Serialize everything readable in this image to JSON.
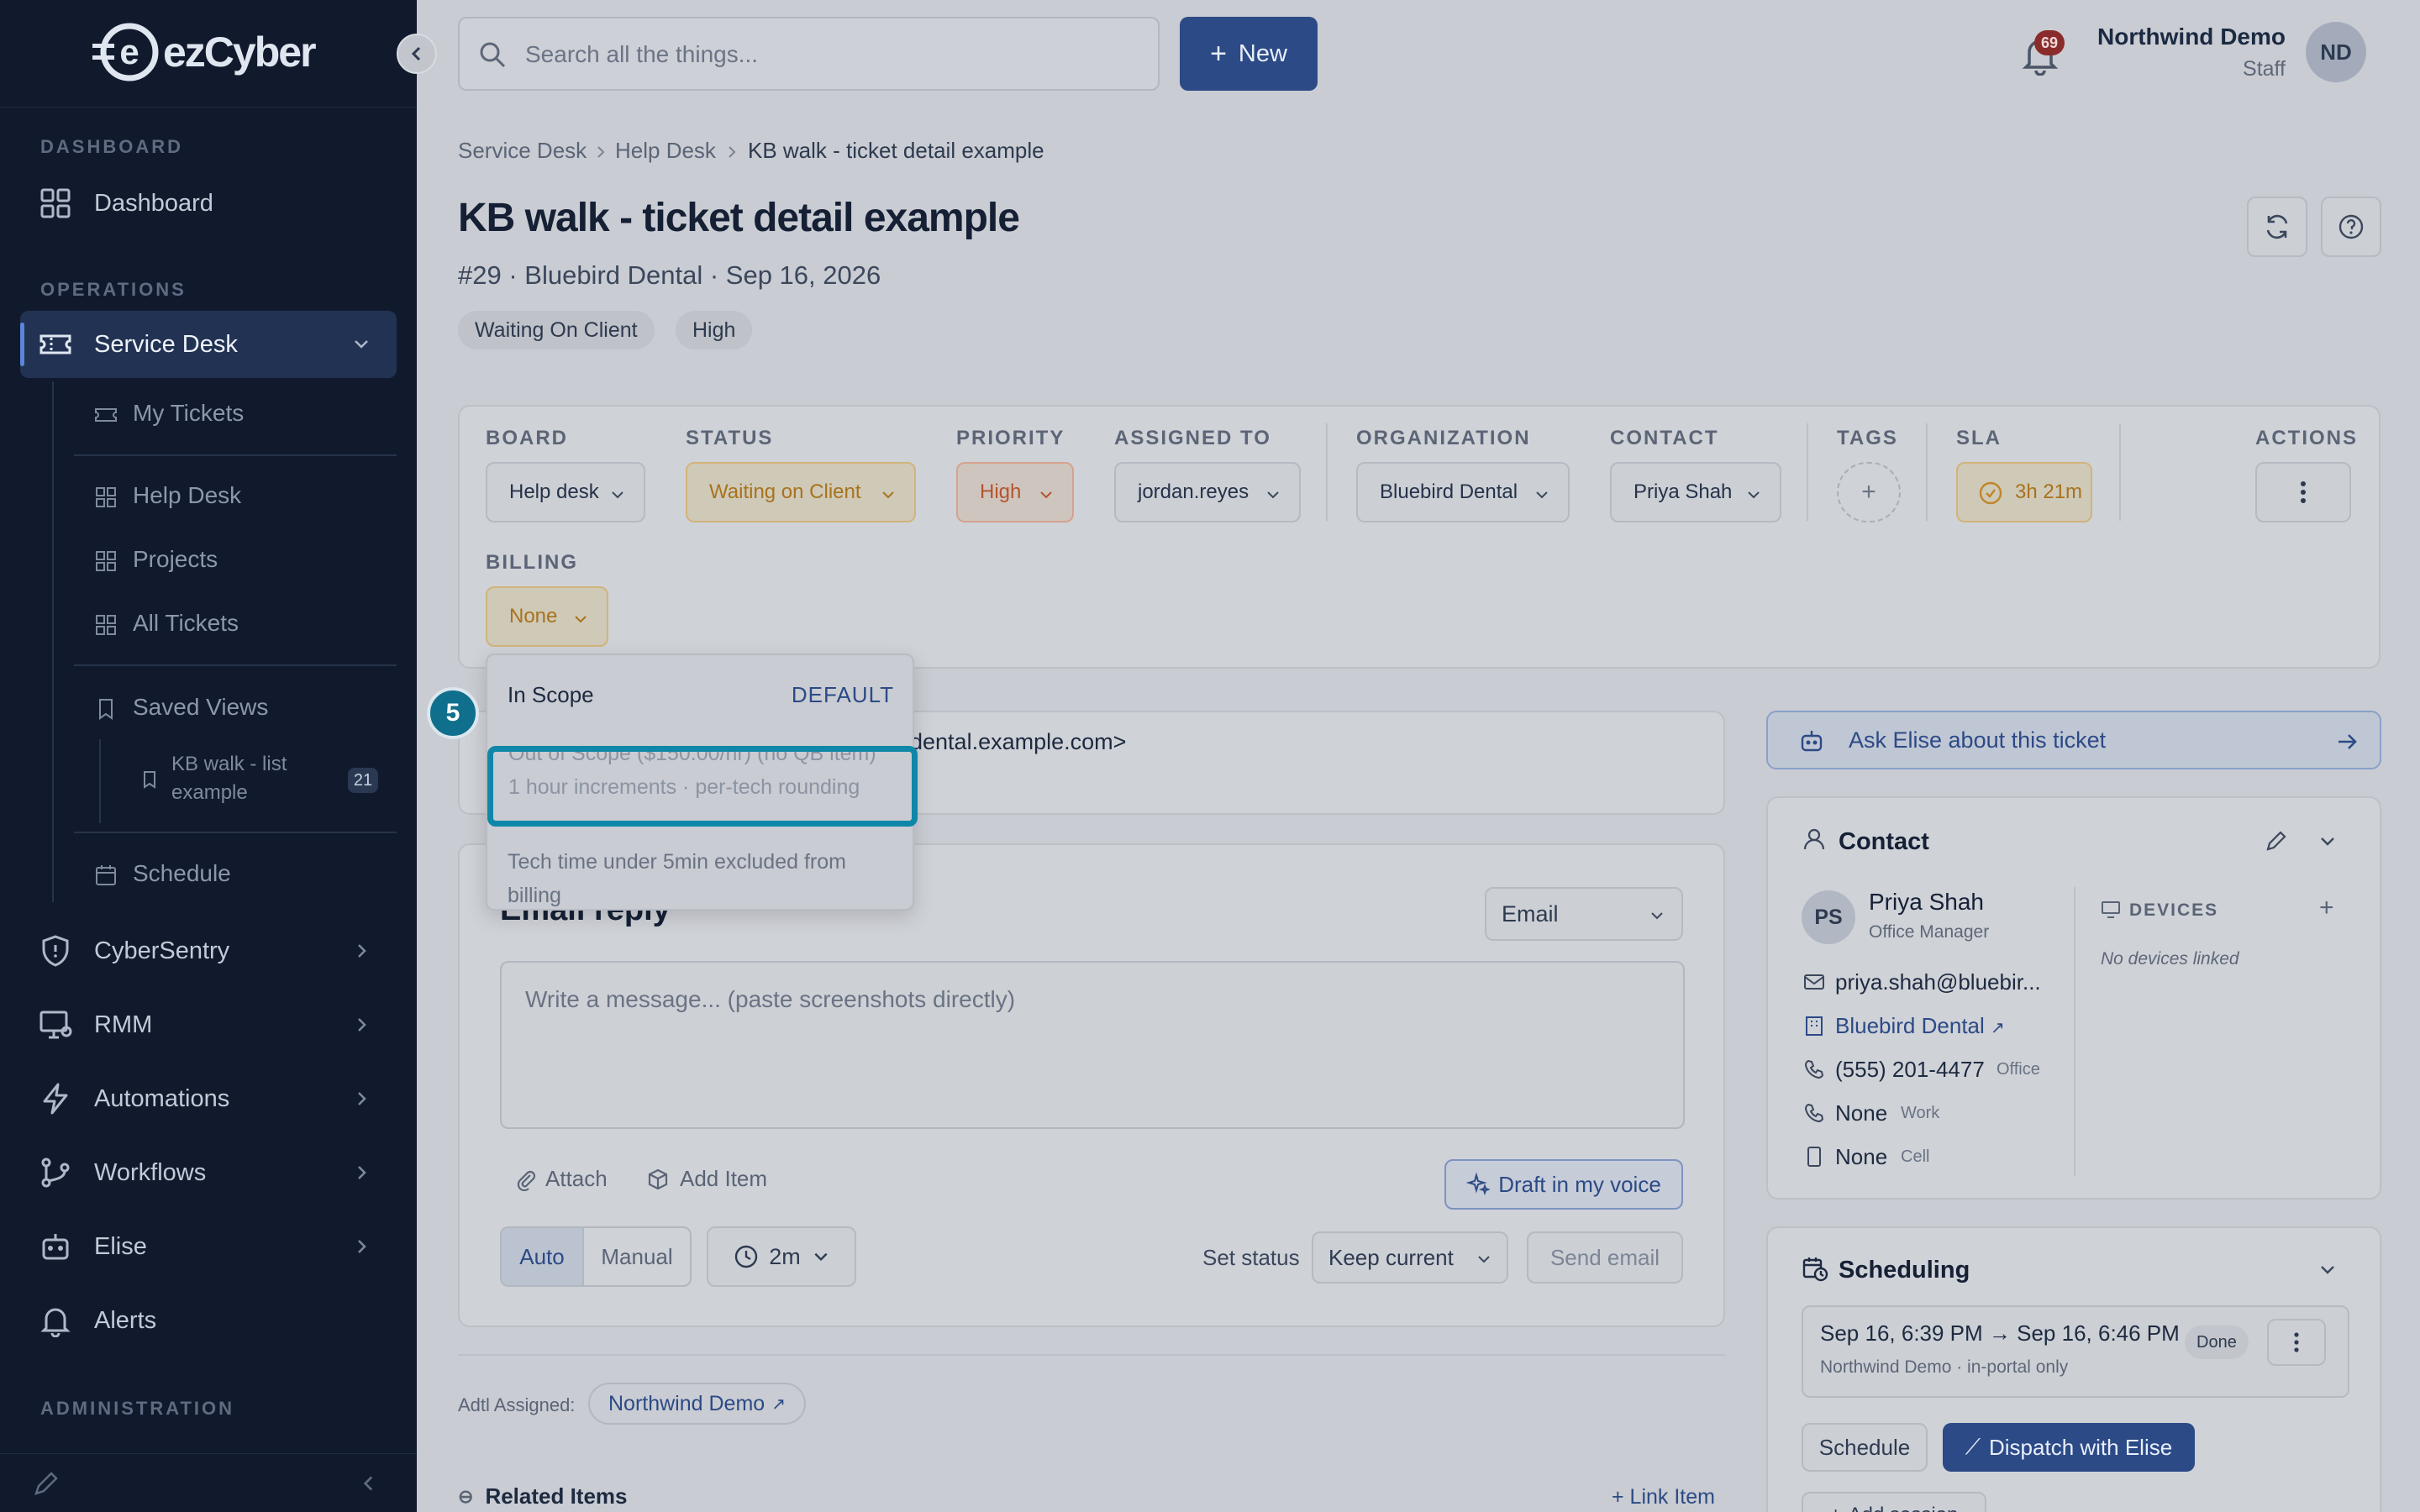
{
  "app": {
    "brand_e": "e",
    "brand_word": "ezCyber"
  },
  "search": {
    "placeholder": "Search all the things..."
  },
  "header": {
    "new_label": "New",
    "notif_count": "69",
    "user_name": "Northwind Demo",
    "user_role": "Staff",
    "avatar": "ND"
  },
  "sidebar": {
    "section_dashboard": "DASHBOARD",
    "dashboard": "Dashboard",
    "section_operations": "OPERATIONS",
    "service_desk": "Service Desk",
    "my_tickets": "My Tickets",
    "help_desk": "Help Desk",
    "projects": "Projects",
    "all_tickets": "All Tickets",
    "saved_views": "Saved Views",
    "kb_walk_1": "KB walk - list",
    "kb_walk_2": "example",
    "kb_walk_count": "21",
    "schedule": "Schedule",
    "cybersentry": "CyberSentry",
    "rmm": "RMM",
    "automations": "Automations",
    "workflows": "Workflows",
    "elise": "Elise",
    "alerts": "Alerts",
    "section_admin": "ADMINISTRATION"
  },
  "breadcrumb": {
    "a": "Service Desk",
    "b": "Help Desk",
    "c": "KB walk - ticket detail example"
  },
  "ticket": {
    "title": "KB walk - ticket detail example",
    "meta": "#29 · Bluebird Dental · Sep 16, 2026",
    "status_pill": "Waiting On Client",
    "priority_pill": "High"
  },
  "fields": {
    "board_label": "BOARD",
    "board": "Help desk",
    "status_label": "STATUS",
    "status": "Waiting on Client",
    "priority_label": "PRIORITY",
    "priority": "High",
    "assigned_label": "ASSIGNED TO",
    "assigned": "jordan.reyes",
    "org_label": "ORGANIZATION",
    "org": "Bluebird Dental",
    "contact_label": "CONTACT",
    "contact": "Priya Shah",
    "tags_label": "TAGS",
    "sla_label": "SLA",
    "sla": "3h 21m",
    "actions_label": "ACTIONS",
    "billing_label": "BILLING",
    "billing": "None"
  },
  "billing_menu": {
    "opt1": "In Scope",
    "opt1_badge": "DEFAULT",
    "opt2": "Out of Scope ($150.00/hr) (no QB item)",
    "opt2_sub": "1 hour increments · per-tech rounding",
    "opt3a": "Tech time under 5min excluded from",
    "opt3b": "billing"
  },
  "step_badge": "5",
  "email_from_tail": "dental.example.com>",
  "reply": {
    "title": "Email reply",
    "channel": "Email",
    "placeholder": "Write a message... (paste screenshots directly)",
    "attach": "Attach",
    "add_item": "Add Item",
    "draft": "Draft in my voice",
    "auto": "Auto",
    "manual": "Manual",
    "time": "2m",
    "set_status": "Set status",
    "keep_current": "Keep current",
    "send": "Send email"
  },
  "adtl": {
    "label": "Adtl Assigned:",
    "value": "Northwind Demo"
  },
  "related": {
    "title": "Related Items",
    "link": "Link Item"
  },
  "ask_elise": "Ask Elise about this ticket",
  "contact": {
    "title": "Contact",
    "initials": "PS",
    "name": "Priya Shah",
    "role": "Office Manager",
    "email": "priya.shah@bluebir...",
    "org": "Bluebird Dental",
    "phone": "(555) 201-4477",
    "phone_type": "Office",
    "work": "None",
    "work_type": "Work",
    "cell": "None",
    "cell_type": "Cell",
    "devices_label": "DEVICES",
    "no_devices": "No devices linked"
  },
  "scheduling": {
    "title": "Scheduling",
    "range": "Sep 16, 6:39 PM → Sep 16, 6:46 PM",
    "sub": "Northwind Demo · in-portal only",
    "done": "Done",
    "schedule_btn": "Schedule",
    "dispatch": "Dispatch with Elise",
    "add_session": "Add session"
  },
  "colors": {
    "sidebar": "#111a2d",
    "accent": "#2c4a86",
    "highlight": "#0f87a8",
    "overlay": "#c9ccd2"
  }
}
